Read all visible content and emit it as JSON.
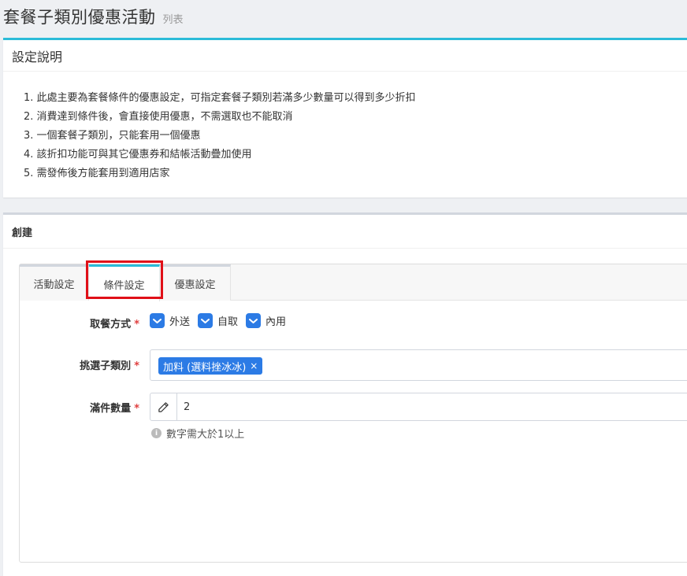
{
  "header": {
    "title": "套餐子類別優惠活動",
    "subtitle": "列表"
  },
  "info": {
    "title": "設定說明",
    "items": [
      "1. 此處主要為套餐條件的優惠設定，可指定套餐子類別若滿多少數量可以得到多少折扣",
      "2. 消費達到條件後，會直接使用優惠，不需選取也不能取消",
      "3. 一個套餐子類別，只能套用一個優惠",
      "4. 該折扣功能可與其它優惠券和結帳活動疊加使用",
      "5. 需發佈後方能套用到適用店家"
    ]
  },
  "create": {
    "title": "創建",
    "tabs": [
      {
        "label": "活動設定"
      },
      {
        "label": "條件設定",
        "active": true,
        "highlighted": true
      },
      {
        "label": "優惠設定"
      }
    ],
    "form": {
      "dining_label": "取餐方式",
      "dining_options": [
        {
          "label": "外送",
          "checked": true
        },
        {
          "label": "自取",
          "checked": true
        },
        {
          "label": "內用",
          "checked": true
        }
      ],
      "category_label": "挑選子類別",
      "selected_category": "加料 (選料挫冰冰)",
      "chip_remove": "×",
      "quantity_label": "滿件數量",
      "quantity_value": "2",
      "quantity_help": "數字需大於1以上",
      "required_mark": "*"
    }
  },
  "colors": {
    "accent": "#2bbbd8",
    "checkbox": "#2c7be5",
    "highlight": "#e01018",
    "required": "#e04040"
  },
  "icons": {
    "pencil": "pencil-icon",
    "check": "check-icon",
    "info": "info-icon"
  }
}
